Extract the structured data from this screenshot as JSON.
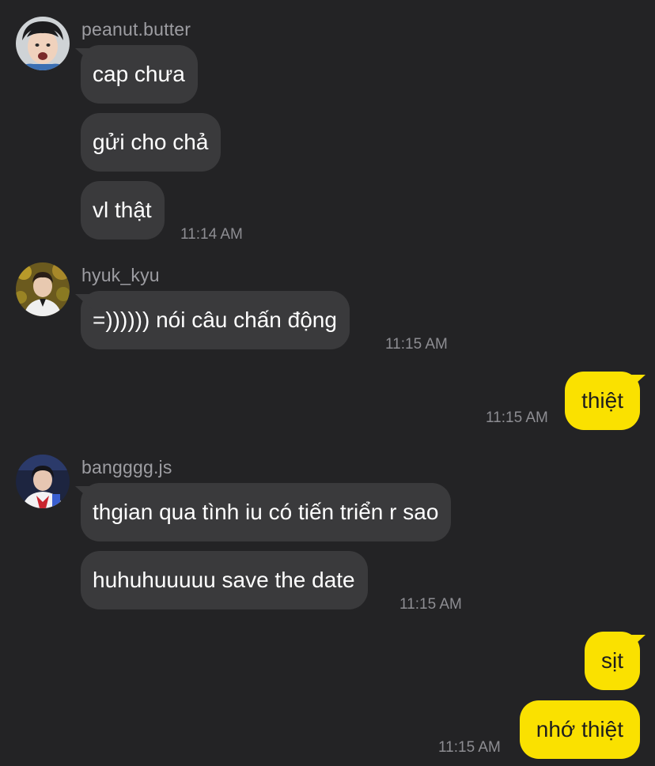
{
  "colors": {
    "background": "#232325",
    "incoming_bubble": "#3a3a3c",
    "outgoing_bubble": "#fae100",
    "sender_text": "#9d9da2",
    "timestamp_text": "#8d8d92"
  },
  "groups": [
    {
      "sender": "peanut.butter",
      "avatar_icon": "user-avatar-peanut-butter",
      "messages": [
        "cap chưa",
        "gửi cho chả",
        "vl thật"
      ],
      "time": "11:14 AM"
    },
    {
      "sender": "hyuk_kyu",
      "avatar_icon": "user-avatar-hyuk-kyu",
      "messages": [
        "=)))))) nói câu chấn động"
      ],
      "time": "11:15 AM"
    },
    {
      "sender": "me",
      "messages": [
        "thiệt"
      ],
      "time": "11:15 AM"
    },
    {
      "sender": "bangggg.js",
      "avatar_icon": "user-avatar-bangggg-js",
      "messages": [
        "thgian qua tình iu có tiến triển r sao",
        "huhuhuuuuu save the date"
      ],
      "time": "11:15 AM"
    },
    {
      "sender": "me",
      "messages": [
        "sịt",
        "nhớ thiệt"
      ],
      "time": "11:15 AM"
    }
  ]
}
